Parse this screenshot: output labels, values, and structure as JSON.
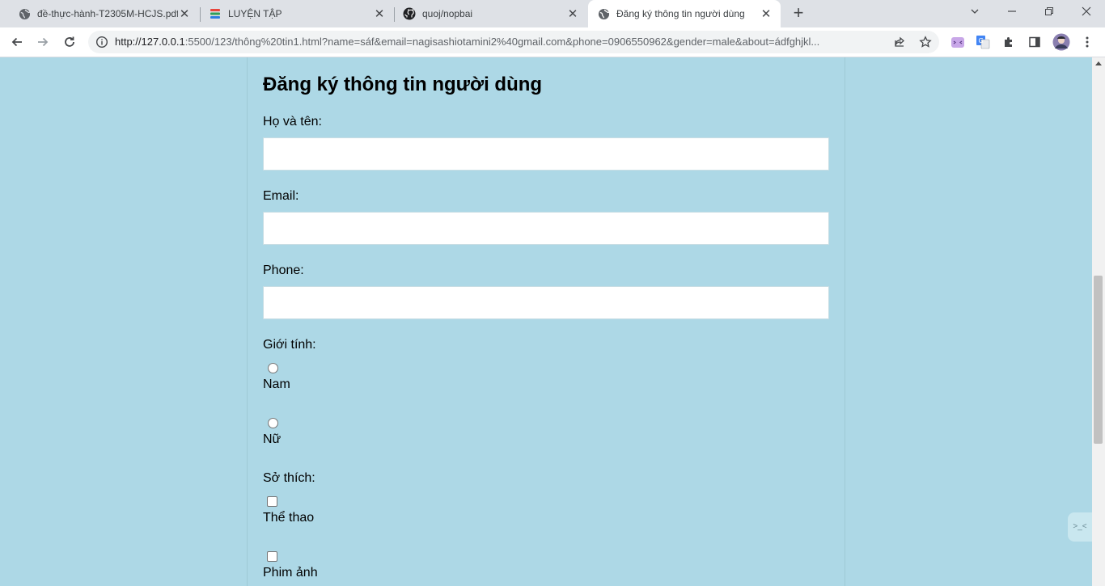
{
  "browser": {
    "tabs": [
      {
        "title": "đề-thực-hành-T2305M-HCJS.pdf",
        "icon": "globe-icon"
      },
      {
        "title": "LUYỆN TẬP",
        "icon": "app-logo-icon"
      },
      {
        "title": "quoj/nopbai",
        "icon": "github-icon"
      },
      {
        "title": "Đăng ký thông tin người dùng",
        "icon": "globe-icon",
        "active": true
      }
    ],
    "url_host": "http://127.0.0.1",
    "url_rest": ":5500/123/thông%20tin1.html?name=sáf&email=nagisashiotamini2%40gmail.com&phone=0906550962&gender=male&about=ádfghjkl..."
  },
  "form": {
    "title": "Đăng ký thông tin người dùng",
    "name_label": "Họ và tên:",
    "name_value": "",
    "email_label": "Email:",
    "email_value": "",
    "phone_label": "Phone:",
    "phone_value": "",
    "gender_label": "Giới tính:",
    "gender_options": [
      "Nam",
      "Nữ"
    ],
    "hobby_label": "Sở thích:",
    "hobby_options": [
      "Thể thao",
      "Phim ảnh"
    ]
  },
  "colors": {
    "page_background": "#add8e6",
    "input_background": "#ffffff"
  }
}
